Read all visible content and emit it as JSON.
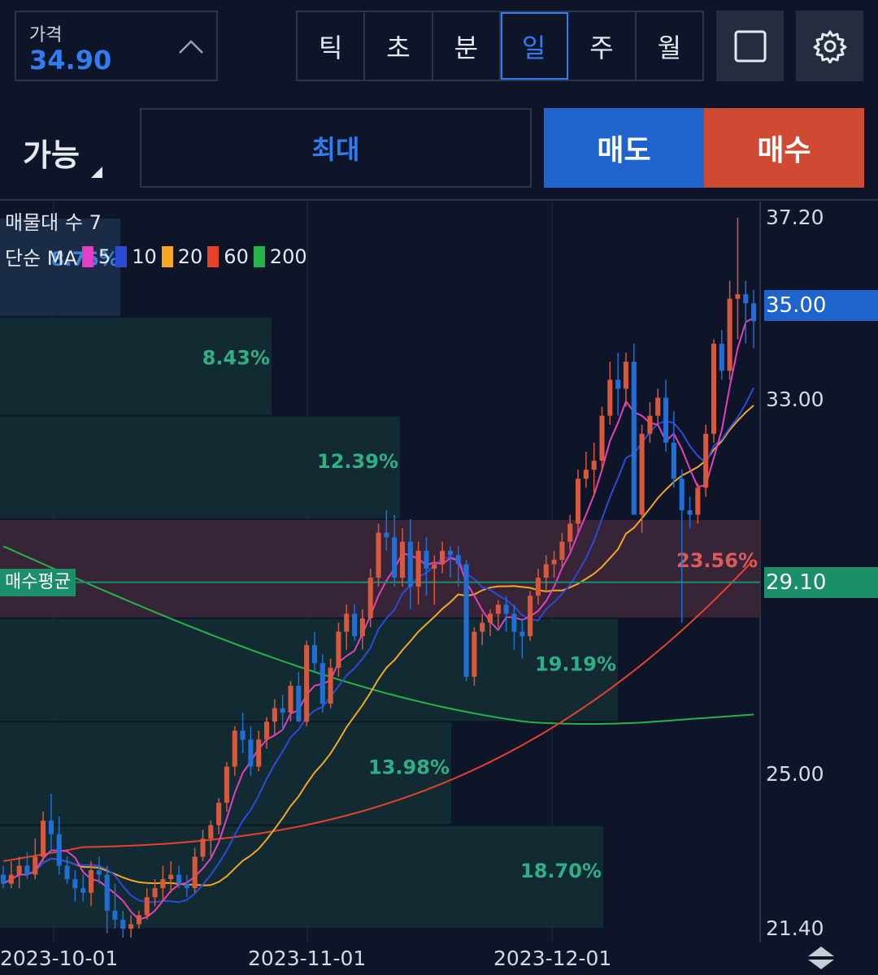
{
  "header": {
    "price_label": "가격",
    "price_value": "34.90",
    "timeframes": [
      "틱",
      "초",
      "분",
      "일",
      "주",
      "월"
    ],
    "active_timeframe": "일",
    "fullscreen_icon": "square-icon",
    "settings_icon": "gear-icon"
  },
  "order": {
    "available_label": "가능",
    "max_label": "최대",
    "sell_label": "매도",
    "buy_label": "매수"
  },
  "legend": {
    "volume_profile": "매물대 수 7",
    "ma_prefix": "단순 MA",
    "ma_periods": [
      "5",
      "10",
      "20",
      "60",
      "200"
    ],
    "ma_colors": [
      "#e43fc2",
      "#2a4bd7",
      "#f5a623",
      "#e8412a",
      "#27b24a"
    ]
  },
  "tags": {
    "current_price": "35.00",
    "avg_price": "29.10",
    "avg_label": "매수평균"
  },
  "colors": {
    "up": "#d9583c",
    "down": "#1f6fd6",
    "background": "#0e1528",
    "accent": "#2f7df0"
  },
  "chart_data": {
    "type": "candlestick",
    "y_ticks": [
      "37.20",
      "35.00",
      "33.00",
      "29.10",
      "25.00",
      "21.40"
    ],
    "x_ticks": [
      "2023-10-01",
      "2023-11-01",
      "2023-12-01"
    ],
    "ylim": [
      21.4,
      37.2
    ],
    "volume_profile": [
      {
        "low": 35.0,
        "high": 37.2,
        "label": "8.75%"
      },
      {
        "low": 32.8,
        "high": 35.0,
        "label": "8.43%"
      },
      {
        "low": 30.5,
        "high": 32.8,
        "label": "12.39%"
      },
      {
        "low": 28.3,
        "high": 30.5,
        "label": "23.56%"
      },
      {
        "low": 26.0,
        "high": 28.3,
        "label": "19.19%"
      },
      {
        "low": 23.7,
        "high": 26.0,
        "label": "13.98%"
      },
      {
        "low": 21.4,
        "high": 23.7,
        "label": "18.70%"
      }
    ],
    "candles": [
      [
        22.6,
        22.8,
        22.3,
        22.4
      ],
      [
        22.4,
        22.9,
        22.3,
        22.6
      ],
      [
        22.6,
        23.0,
        22.3,
        22.8
      ],
      [
        22.8,
        23.1,
        22.5,
        22.6
      ],
      [
        22.6,
        23.4,
        22.5,
        23.0
      ],
      [
        23.0,
        24.0,
        22.9,
        23.8
      ],
      [
        23.8,
        24.4,
        23.1,
        23.5
      ],
      [
        23.5,
        23.9,
        22.6,
        22.8
      ],
      [
        22.8,
        23.0,
        22.4,
        22.5
      ],
      [
        22.5,
        22.7,
        22.0,
        22.3
      ],
      [
        22.3,
        22.6,
        22.0,
        22.2
      ],
      [
        22.2,
        22.9,
        21.9,
        22.7
      ],
      [
        22.7,
        23.0,
        22.4,
        22.6
      ],
      [
        22.6,
        22.8,
        21.3,
        21.8
      ],
      [
        21.8,
        22.4,
        21.4,
        21.6
      ],
      [
        21.6,
        21.8,
        21.2,
        21.4
      ],
      [
        21.4,
        21.7,
        21.2,
        21.5
      ],
      [
        21.5,
        21.8,
        21.4,
        21.7
      ],
      [
        21.7,
        22.3,
        21.6,
        22.1
      ],
      [
        22.1,
        22.5,
        21.9,
        22.3
      ],
      [
        22.3,
        22.8,
        22.0,
        22.5
      ],
      [
        22.5,
        22.9,
        22.2,
        22.6
      ],
      [
        22.6,
        22.8,
        22.3,
        22.4
      ],
      [
        22.4,
        22.6,
        22.1,
        22.3
      ],
      [
        22.3,
        23.2,
        22.2,
        23.0
      ],
      [
        23.0,
        23.6,
        22.9,
        23.4
      ],
      [
        23.4,
        23.8,
        23.0,
        23.7
      ],
      [
        23.7,
        24.3,
        23.5,
        24.2
      ],
      [
        24.2,
        25.1,
        24.0,
        25.0
      ],
      [
        25.0,
        25.9,
        24.8,
        25.8
      ],
      [
        25.8,
        26.2,
        25.3,
        25.6
      ],
      [
        25.6,
        25.9,
        24.8,
        25.0
      ],
      [
        25.0,
        25.8,
        24.9,
        25.6
      ],
      [
        25.6,
        26.1,
        25.4,
        26.0
      ],
      [
        26.0,
        26.5,
        25.7,
        26.3
      ],
      [
        26.3,
        26.6,
        25.8,
        26.2
      ],
      [
        26.2,
        26.9,
        26.0,
        26.8
      ],
      [
        26.8,
        27.1,
        26.0,
        26.0
      ],
      [
        26.0,
        27.8,
        25.9,
        27.7
      ],
      [
        27.7,
        28.0,
        27.1,
        27.3
      ],
      [
        27.3,
        27.5,
        26.2,
        26.4
      ],
      [
        26.4,
        27.4,
        26.3,
        27.2
      ],
      [
        27.2,
        28.2,
        27.0,
        28.0
      ],
      [
        28.0,
        28.6,
        27.6,
        28.4
      ],
      [
        28.4,
        28.6,
        27.8,
        27.9
      ],
      [
        27.9,
        28.5,
        27.6,
        28.3
      ],
      [
        28.3,
        29.4,
        28.1,
        29.2
      ],
      [
        29.2,
        30.4,
        29.0,
        30.2
      ],
      [
        30.2,
        30.7,
        29.8,
        30.1
      ],
      [
        30.1,
        30.6,
        29.0,
        29.2
      ],
      [
        29.2,
        30.3,
        29.0,
        30.0
      ],
      [
        30.0,
        30.5,
        28.5,
        29.0
      ],
      [
        29.0,
        30.0,
        28.6,
        29.8
      ],
      [
        29.8,
        30.1,
        28.8,
        29.4
      ],
      [
        29.4,
        29.7,
        28.6,
        29.5
      ],
      [
        29.5,
        30.0,
        29.3,
        29.8
      ],
      [
        29.8,
        29.9,
        29.2,
        29.7
      ],
      [
        29.7,
        29.9,
        29.0,
        29.5
      ],
      [
        29.5,
        29.6,
        26.9,
        27.0
      ],
      [
        27.0,
        28.1,
        26.8,
        28.0
      ],
      [
        28.0,
        28.4,
        27.7,
        28.2
      ],
      [
        28.2,
        28.5,
        27.9,
        28.4
      ],
      [
        28.4,
        28.7,
        28.1,
        28.6
      ],
      [
        28.6,
        28.8,
        28.0,
        28.4
      ],
      [
        28.4,
        28.6,
        27.6,
        28.0
      ],
      [
        28.0,
        28.3,
        27.4,
        27.9
      ],
      [
        27.9,
        28.9,
        27.8,
        28.8
      ],
      [
        28.8,
        29.4,
        28.6,
        29.2
      ],
      [
        29.2,
        29.7,
        28.9,
        29.5
      ],
      [
        29.5,
        29.8,
        29.2,
        29.6
      ],
      [
        29.6,
        30.2,
        29.4,
        30.0
      ],
      [
        30.0,
        30.6,
        29.8,
        30.4
      ],
      [
        30.4,
        31.6,
        30.2,
        31.4
      ],
      [
        31.4,
        32.0,
        31.2,
        31.6
      ],
      [
        31.6,
        32.2,
        31.0,
        31.8
      ],
      [
        31.8,
        33.0,
        31.6,
        32.8
      ],
      [
        32.8,
        34.0,
        32.6,
        33.6
      ],
      [
        33.6,
        34.2,
        32.8,
        33.4
      ],
      [
        33.4,
        34.2,
        33.0,
        34.0
      ],
      [
        34.0,
        34.4,
        32.0,
        30.6
      ],
      [
        30.6,
        32.6,
        30.2,
        32.4
      ],
      [
        32.4,
        33.1,
        32.2,
        32.8
      ],
      [
        32.8,
        33.4,
        32.6,
        33.2
      ],
      [
        33.2,
        33.6,
        32.0,
        32.2
      ],
      [
        32.2,
        32.9,
        31.2,
        31.4
      ],
      [
        31.4,
        31.6,
        28.2,
        30.7
      ],
      [
        30.7,
        31.0,
        30.3,
        30.6
      ],
      [
        30.6,
        31.3,
        30.4,
        31.2
      ],
      [
        31.2,
        32.6,
        31.0,
        32.4
      ],
      [
        32.4,
        34.5,
        32.2,
        34.4
      ],
      [
        34.4,
        34.7,
        33.6,
        33.8
      ],
      [
        33.8,
        35.8,
        33.6,
        35.4
      ],
      [
        35.4,
        37.2,
        34.5,
        35.5
      ],
      [
        35.5,
        35.8,
        34.4,
        35.3
      ],
      [
        35.3,
        35.6,
        34.3,
        34.9
      ]
    ]
  }
}
